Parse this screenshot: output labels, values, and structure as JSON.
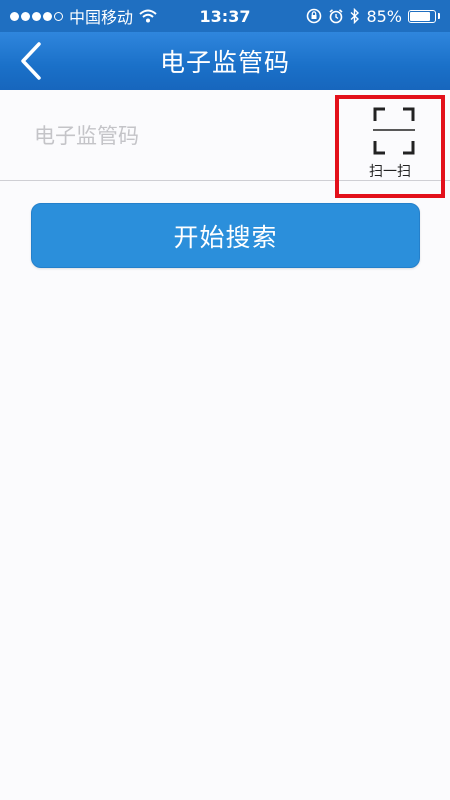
{
  "status_bar": {
    "carrier": "中国移动",
    "time": "13:37",
    "battery": "85%",
    "battery_level": 0.85
  },
  "nav": {
    "title": "电子监管码",
    "back_icon": "chevron-left-icon"
  },
  "form": {
    "code_placeholder": "电子监管码",
    "code_value": ""
  },
  "scan": {
    "label": "扫一扫",
    "icon": "scan-frame-icon"
  },
  "actions": {
    "search_label": "开始搜索"
  },
  "colors": {
    "nav_bar": "#1f6fc1",
    "button": "#2b8fdb",
    "highlight": "#e3101b"
  }
}
